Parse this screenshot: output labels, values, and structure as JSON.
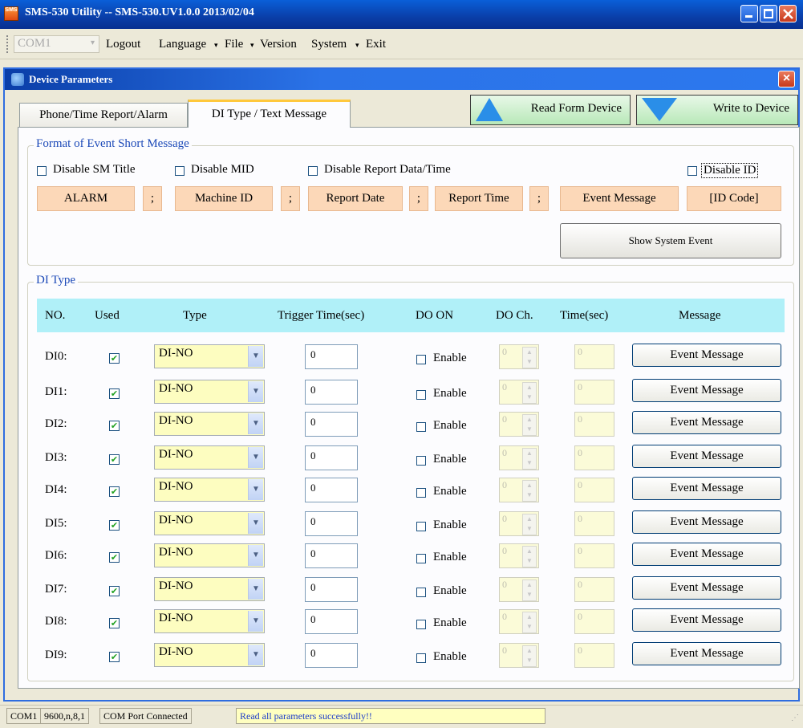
{
  "window": {
    "title": "SMS-530 Utility -- SMS-530.UV1.0.0 2013/02/04",
    "app_icon_text": "SMS"
  },
  "menu": {
    "com_port": "COM1",
    "items": [
      "Logout",
      "Language",
      "File",
      "Version",
      "System",
      "Exit"
    ]
  },
  "child": {
    "title": "Device Parameters"
  },
  "tabs": [
    "Phone/Time Report/Alarm",
    "DI Type / Text Message"
  ],
  "buttons": {
    "read": "Read Form Device",
    "write": "Write to Device",
    "show_system_event": "Show System Event"
  },
  "format": {
    "legend": "Format of Event Short Message",
    "options": [
      "Disable SM Title",
      "Disable MID",
      "Disable Report Data/Time",
      "Disable ID"
    ],
    "fields": [
      "ALARM",
      ";",
      "Machine ID",
      ";",
      "Report Date",
      ";",
      "Report Time",
      ";",
      "Event Message",
      "[ID Code]"
    ]
  },
  "di": {
    "legend": "DI Type",
    "headers": [
      "NO.",
      "Used",
      "Type",
      "Trigger Time(sec)",
      "DO ON",
      "DO Ch.",
      "Time(sec)",
      "Message"
    ],
    "rows": [
      {
        "no": "DI0:",
        "type": "DI-NO",
        "trigger": "0",
        "do_on": "Enable",
        "do_ch": "0",
        "time": "0",
        "message": "Event Message"
      },
      {
        "no": "DI1:",
        "type": "DI-NO",
        "trigger": "0",
        "do_on": "Enable",
        "do_ch": "0",
        "time": "0",
        "message": "Event Message"
      },
      {
        "no": "DI2:",
        "type": "DI-NO",
        "trigger": "0",
        "do_on": "Enable",
        "do_ch": "0",
        "time": "0",
        "message": "Event Message"
      },
      {
        "no": "DI3:",
        "type": "DI-NO",
        "trigger": "0",
        "do_on": "Enable",
        "do_ch": "0",
        "time": "0",
        "message": "Event Message"
      },
      {
        "no": "DI4:",
        "type": "DI-NO",
        "trigger": "0",
        "do_on": "Enable",
        "do_ch": "0",
        "time": "0",
        "message": "Event Message"
      },
      {
        "no": "DI5:",
        "type": "DI-NO",
        "trigger": "0",
        "do_on": "Enable",
        "do_ch": "0",
        "time": "0",
        "message": "Event Message"
      },
      {
        "no": "DI6:",
        "type": "DI-NO",
        "trigger": "0",
        "do_on": "Enable",
        "do_ch": "0",
        "time": "0",
        "message": "Event Message"
      },
      {
        "no": "DI7:",
        "type": "DI-NO",
        "trigger": "0",
        "do_on": "Enable",
        "do_ch": "0",
        "time": "0",
        "message": "Event Message"
      },
      {
        "no": "DI8:",
        "type": "DI-NO",
        "trigger": "0",
        "do_on": "Enable",
        "do_ch": "0",
        "time": "0",
        "message": "Event Message"
      },
      {
        "no": "DI9:",
        "type": "DI-NO",
        "trigger": "0",
        "do_on": "Enable",
        "do_ch": "0",
        "time": "0",
        "message": "Event Message"
      }
    ]
  },
  "status": [
    "COM1",
    "9600,n,8,1",
    "COM Port Connected",
    "Read all parameters successfully!!"
  ],
  "colors": {
    "accent": "#2a8ee8",
    "status_highlight": "#ffffc0",
    "message_text": "#1d3cc8"
  }
}
